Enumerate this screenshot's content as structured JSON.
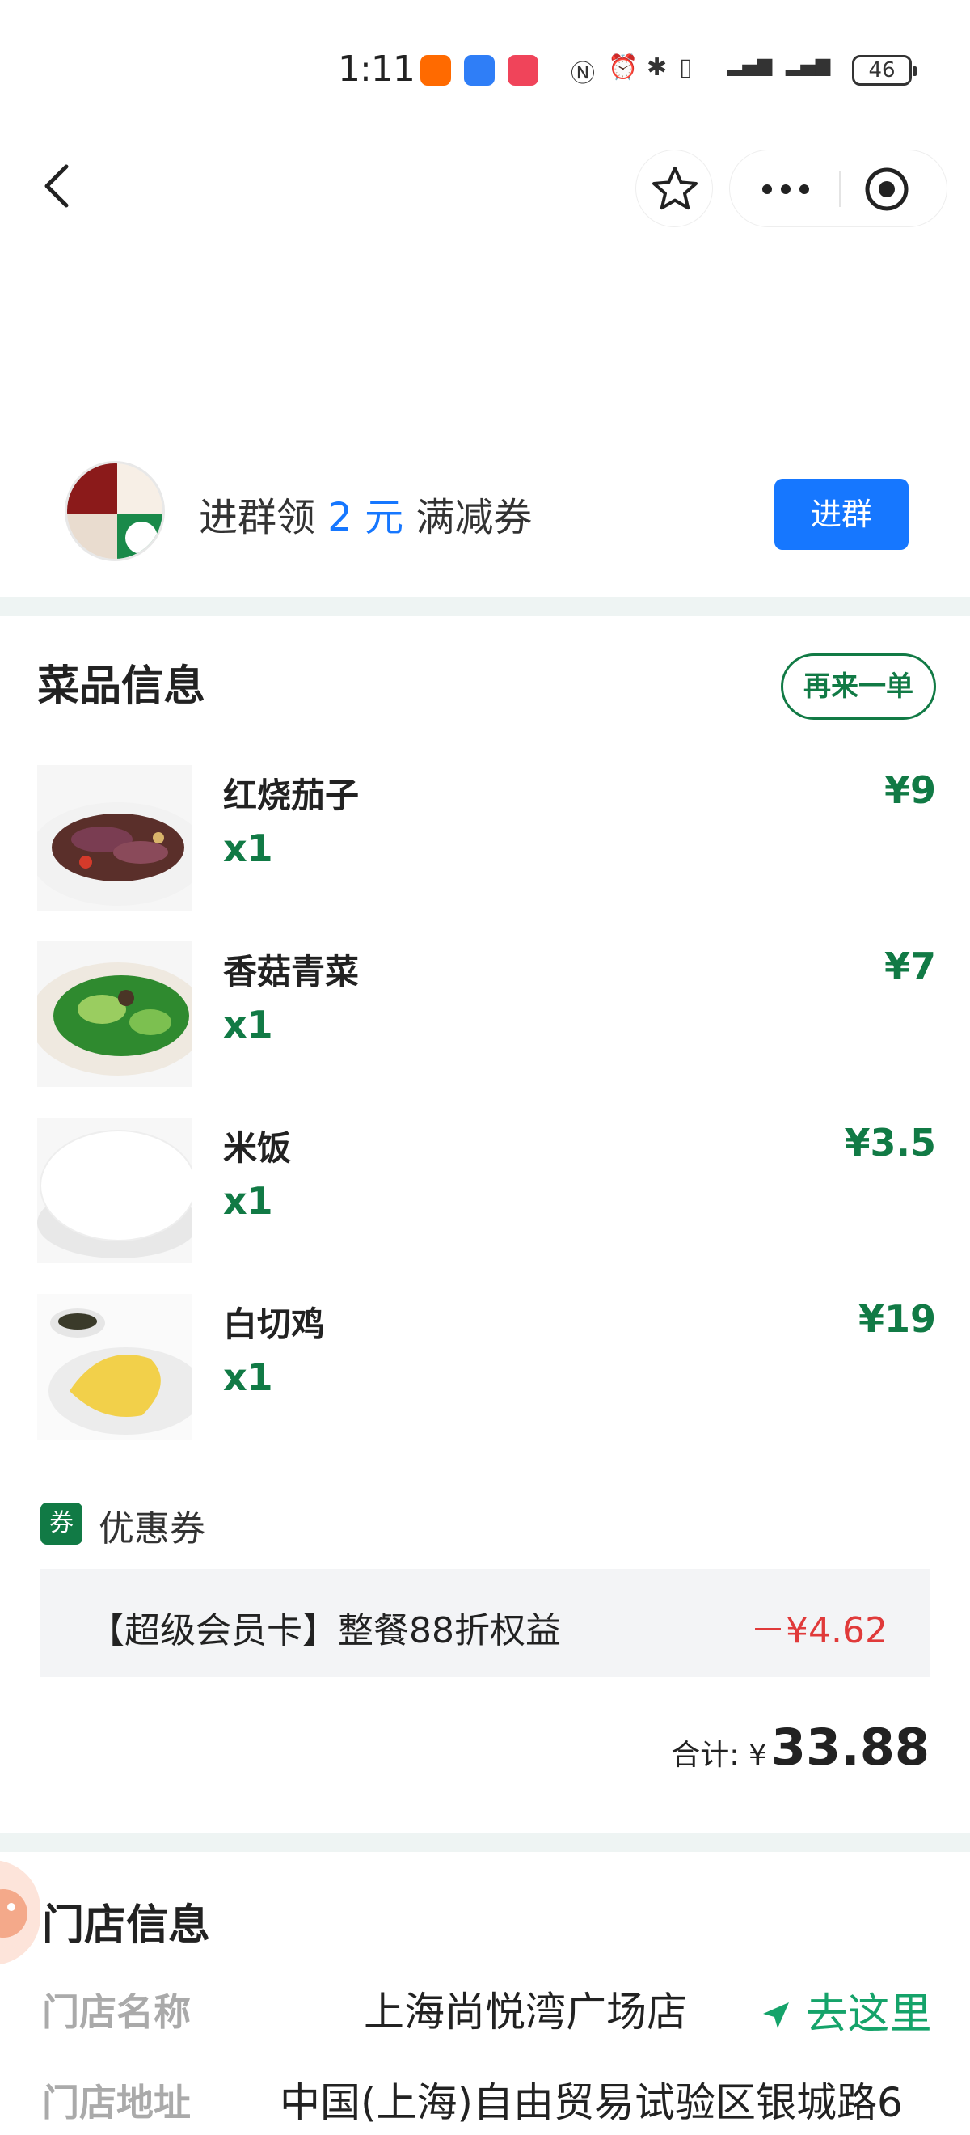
{
  "status_bar": {
    "time": "1:11",
    "battery": "46"
  },
  "nav": {
    "back_icon": "chevron-left-icon",
    "favorite_icon": "star-icon",
    "more_icon": "more-dots-icon",
    "close_icon": "target-icon"
  },
  "group_banner": {
    "text_prefix": "进群领",
    "amount": "2 元",
    "text_suffix": "满减券",
    "button": "进群"
  },
  "dishes": {
    "title": "菜品信息",
    "reorder_button": "再来一单",
    "items": [
      {
        "name": "红烧茄子",
        "qty": "x1",
        "price": "¥9"
      },
      {
        "name": "香菇青菜",
        "qty": "x1",
        "price": "¥7"
      },
      {
        "name": "米饭",
        "qty": "x1",
        "price": "¥3.5"
      },
      {
        "name": "白切鸡",
        "qty": "x1",
        "price": "¥19"
      }
    ]
  },
  "coupon": {
    "tag": "券",
    "label": "优惠券",
    "description": "【超级会员卡】整餐88折权益",
    "amount": "－¥4.62"
  },
  "total": {
    "label": "合计: ¥",
    "value": "33.88"
  },
  "store": {
    "title": "门店信息",
    "name_key": "门店名称",
    "name_value": "上海尚悦湾广场店",
    "navigate": "去这里",
    "address_key": "门店地址",
    "address_value": "中国(上海)自由贸易试验区银城路6"
  },
  "colors": {
    "accent_green": "#117a45",
    "brand_blue": "#1677ff",
    "discount_red": "#e03a3a"
  }
}
